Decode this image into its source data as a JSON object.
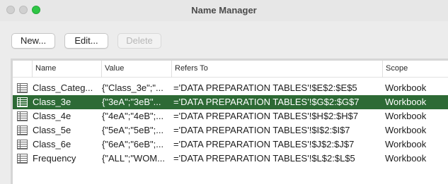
{
  "window": {
    "title": "Name Manager"
  },
  "toolbar": {
    "new_label": "New...",
    "edit_label": "Edit...",
    "delete_label": "Delete"
  },
  "table": {
    "columns": {
      "name": "Name",
      "value": "Value",
      "refers_to": "Refers To",
      "scope": "Scope"
    },
    "rows": [
      {
        "name": "Class_Categ...",
        "value": "{\"Class_3e\";\"...",
        "refers_to": "='DATA PREPARATION TABLES'!$E$2:$E$5",
        "scope": "Workbook"
      },
      {
        "name": "Class_3e",
        "value": "{\"3eA\";\"3eB\"...",
        "refers_to": "='DATA PREPARATION TABLES'!$G$2:$G$7",
        "scope": "Workbook"
      },
      {
        "name": "Class_4e",
        "value": "{\"4eA\";\"4eB\";...",
        "refers_to": "='DATA PREPARATION TABLES'!$H$2:$H$7",
        "scope": "Workbook"
      },
      {
        "name": "Class_5e",
        "value": "{\"5eA\";\"5eB\";...",
        "refers_to": "='DATA PREPARATION TABLES'!$I$2:$I$7",
        "scope": "Workbook"
      },
      {
        "name": "Class_6e",
        "value": "{\"6eA\";\"6eB\";...",
        "refers_to": "='DATA PREPARATION TABLES'!$J$2:$J$7",
        "scope": "Workbook"
      },
      {
        "name": "Frequency",
        "value": "{\"ALL\";\"WOM...",
        "refers_to": "='DATA PREPARATION TABLES'!$L$2:$L$5",
        "scope": "Workbook"
      }
    ],
    "selected_row": 1
  },
  "colors": {
    "selection": "#2d6a35",
    "zoom_button": "#2ec645"
  },
  "icons": {
    "row_icon": "range-grid-icon"
  }
}
